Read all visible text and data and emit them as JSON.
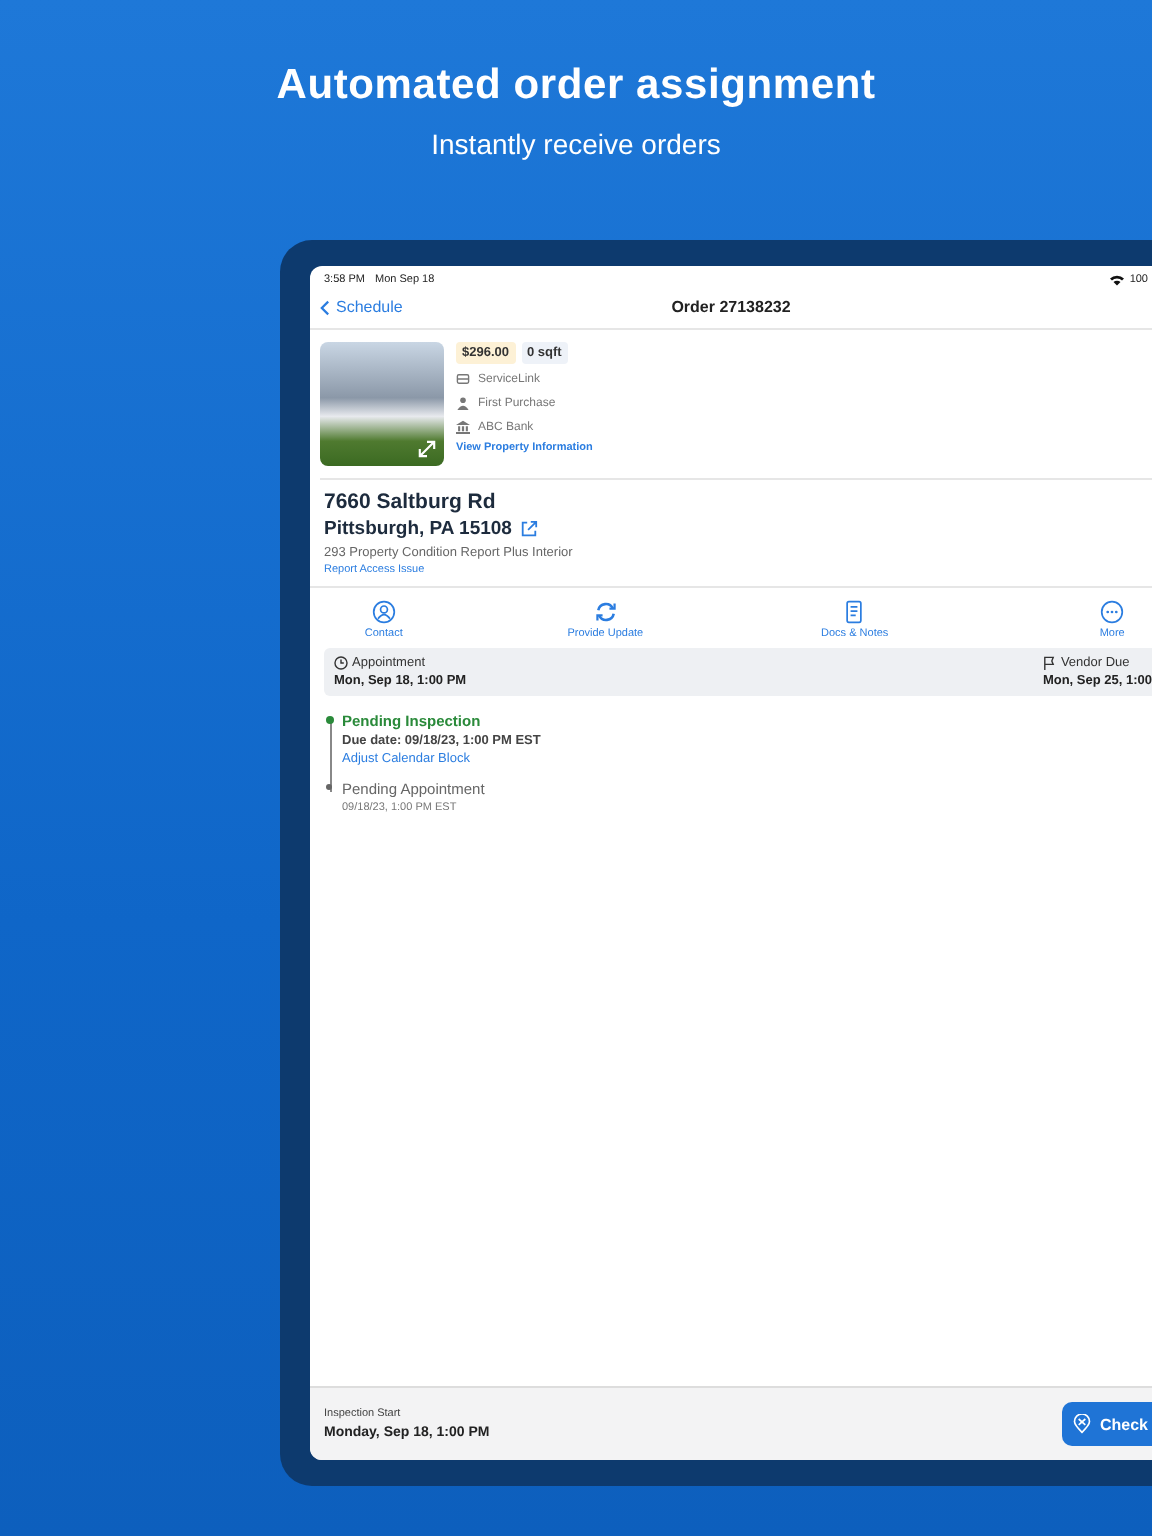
{
  "headline": "Automated order assignment",
  "subheadline": "Instantly receive orders",
  "status_bar": {
    "time": "3:58 PM",
    "date": "Mon Sep 18",
    "battery": "100"
  },
  "nav": {
    "back": "Schedule",
    "title": "Order 27138232"
  },
  "property": {
    "price": "$296.00",
    "area": "0 sqft",
    "details": [
      {
        "kind": "client",
        "text": "ServiceLink"
      },
      {
        "kind": "loan",
        "text": "First Purchase"
      },
      {
        "kind": "bank",
        "text": "ABC Bank"
      }
    ],
    "link": "View Property Information"
  },
  "address": {
    "street": "7660 Saltburg Rd",
    "city": "Pittsburgh, PA 15108",
    "product": "293 Property Condition Report Plus Interior",
    "link": "Report Access Issue"
  },
  "actions": [
    {
      "kind": "contact",
      "label": "Contact"
    },
    {
      "kind": "update",
      "label": "Provide Update"
    },
    {
      "kind": "docs",
      "label": "Docs & Notes"
    },
    {
      "kind": "more",
      "label": "More"
    }
  ],
  "dates": [
    {
      "kind": "clock",
      "label": "Appointment",
      "value": "Mon, Sep 18, 1:00 PM"
    },
    {
      "kind": "flag",
      "label": "Vendor Due",
      "value": "Mon, Sep 25, 1:00"
    }
  ],
  "timeline": [
    {
      "title": "Pending Inspection",
      "detail": "Due date: 09/18/23, 1:00 PM EST",
      "link": "Adjust Calendar Block",
      "selected": true
    },
    {
      "title": "Pending Appointment",
      "detail": "09/18/23, 1:00 PM EST",
      "selected": false
    }
  ],
  "footer": {
    "label": "Inspection Start",
    "value": "Monday, Sep 18, 1:00 PM",
    "button": "Check"
  }
}
